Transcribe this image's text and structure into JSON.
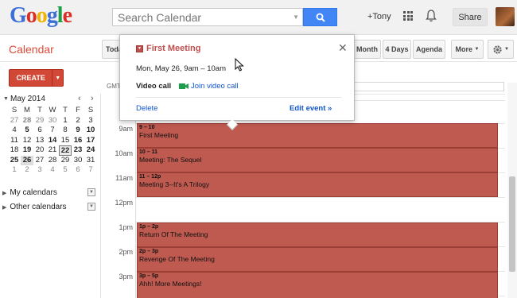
{
  "header": {
    "logo_letters": [
      {
        "ch": "G",
        "color": "#3b6fd6"
      },
      {
        "ch": "o",
        "color": "#d93025"
      },
      {
        "ch": "o",
        "color": "#f0b400"
      },
      {
        "ch": "g",
        "color": "#3b6fd6"
      },
      {
        "ch": "l",
        "color": "#1e9e4a"
      },
      {
        "ch": "e",
        "color": "#d93025"
      }
    ],
    "search_placeholder": "Search Calendar",
    "user_link": "+Tony",
    "share_label": "Share"
  },
  "toolbar": {
    "app_title": "Calendar",
    "today_label": "Today",
    "views": [
      "Month",
      "4 Days",
      "Agenda"
    ],
    "more_label": "More"
  },
  "sidebar": {
    "create_label": "CREATE",
    "mini_calendar": {
      "month_label": "May 2014",
      "prev": "‹",
      "next": "›",
      "dow": [
        "S",
        "M",
        "T",
        "W",
        "T",
        "F",
        "S"
      ],
      "weeks": [
        [
          "27",
          "28",
          "29",
          "30",
          "1",
          "2",
          "3"
        ],
        [
          "4",
          "5",
          "6",
          "7",
          "8",
          "9",
          "10"
        ],
        [
          "11",
          "12",
          "13",
          "14",
          "15",
          "16",
          "17"
        ],
        [
          "18",
          "19",
          "20",
          "21",
          "22",
          "23",
          "24"
        ],
        [
          "25",
          "26",
          "27",
          "28",
          "29",
          "30",
          "31"
        ],
        [
          "1",
          "2",
          "3",
          "4",
          "5",
          "6",
          "7"
        ]
      ]
    },
    "sections": [
      "My calendars",
      "Other calendars"
    ]
  },
  "grid": {
    "timezone": "GMT",
    "hours": [
      "9am",
      "10am",
      "11am",
      "12pm",
      "1pm",
      "2pm",
      "3pm"
    ]
  },
  "events": [
    {
      "time": "9 – 10",
      "title": "First Meeting"
    },
    {
      "time": "10 – 11",
      "title": "Meeting: The Sequel"
    },
    {
      "time": "11 – 12p",
      "title": "Meeting 3--It's A Trilogy"
    },
    {
      "time": "1p – 2p",
      "title": "Return Of The Meeting"
    },
    {
      "time": "2p – 3p",
      "title": "Revenge Of The Meeting"
    },
    {
      "time": "3p – 5p",
      "title": "Ahh! More Meetings!"
    }
  ],
  "popup": {
    "title": "First Meeting",
    "when": "Mon, May 26, 9am – 10am",
    "video_label": "Video call",
    "video_link": "Join video call",
    "delete_label": "Delete",
    "edit_label": "Edit event »"
  },
  "colors": {
    "accent_red": "#dd4b39",
    "event_fill": "#bf5a50",
    "link_blue": "#1155cc",
    "search_blue": "#4285f4"
  }
}
